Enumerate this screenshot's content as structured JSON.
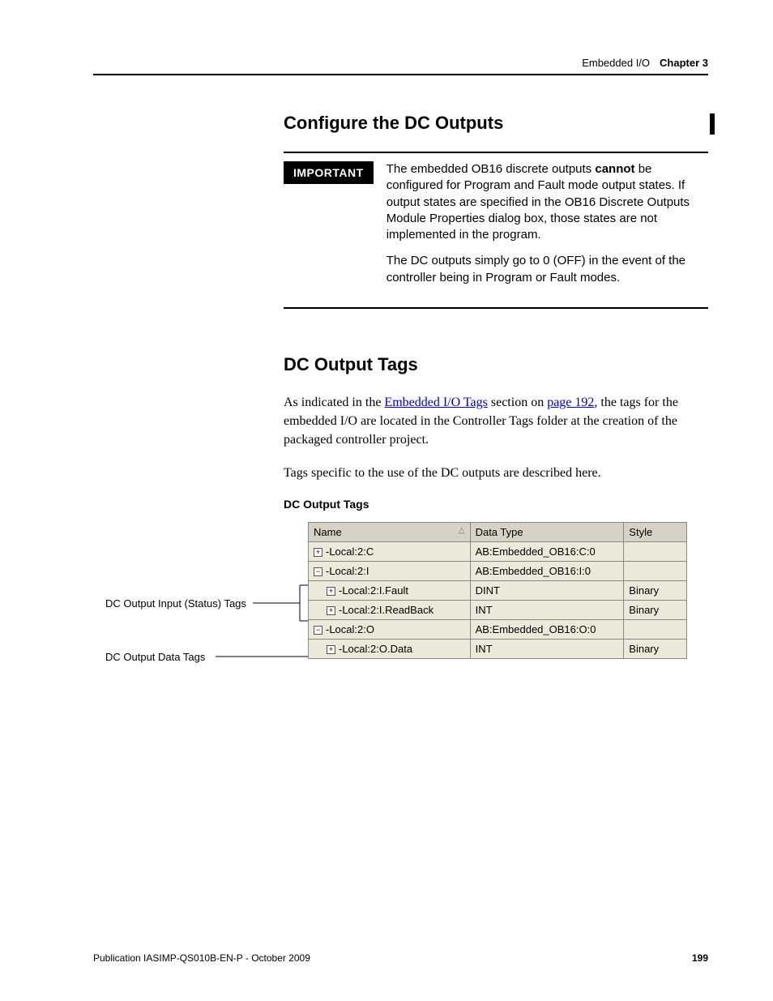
{
  "header": {
    "section": "Embedded I/O",
    "chapter_label": "Chapter 3"
  },
  "section1": {
    "title": "Configure the DC Outputs",
    "important_label": "IMPORTANT",
    "important_p1a": "The embedded OB16 discrete outputs ",
    "important_p1_bold": "cannot",
    "important_p1b": " be configured for Program and Fault mode output states. If output states are specified in the OB16 Discrete Outputs Module Properties dialog box, those states are not implemented in the program.",
    "important_p2": "The DC outputs simply go to 0 (OFF) in the event of the controller being in Program or Fault modes."
  },
  "section2": {
    "title": "DC Output Tags",
    "p1a": "As indicated in the ",
    "p1_link1": "Embedded I/O Tags",
    "p1b": " section on ",
    "p1_link2": "page 192",
    "p1c": ", the tags for the embedded I/O are located in the Controller Tags folder at the creation of the packaged controller project.",
    "p2": "Tags specific to the use of the DC outputs are described here.",
    "table_caption": "DC Output Tags"
  },
  "table": {
    "headers": {
      "name": "Name",
      "type": "Data Type",
      "style": "Style"
    },
    "rows": [
      {
        "expand": "+",
        "indent": 0,
        "name": "Local:2:C",
        "type": "AB:Embedded_OB16:C:0",
        "style": ""
      },
      {
        "expand": "−",
        "indent": 0,
        "name": "Local:2:I",
        "type": "AB:Embedded_OB16:I:0",
        "style": ""
      },
      {
        "expand": "+",
        "indent": 1,
        "name": "Local:2:I.Fault",
        "type": "DINT",
        "style": "Binary"
      },
      {
        "expand": "+",
        "indent": 1,
        "name": "Local:2:I.ReadBack",
        "type": "INT",
        "style": "Binary"
      },
      {
        "expand": "−",
        "indent": 0,
        "name": "Local:2:O",
        "type": "AB:Embedded_OB16:O:0",
        "style": ""
      },
      {
        "expand": "+",
        "indent": 1,
        "name": "Local:2:O.Data",
        "type": "INT",
        "style": "Binary"
      }
    ]
  },
  "callouts": {
    "c1": "DC Output Input (Status) Tags",
    "c2": "DC Output Data Tags"
  },
  "footer": {
    "pub": "Publication IASIMP-QS010B-EN-P - October 2009",
    "page": "199"
  }
}
